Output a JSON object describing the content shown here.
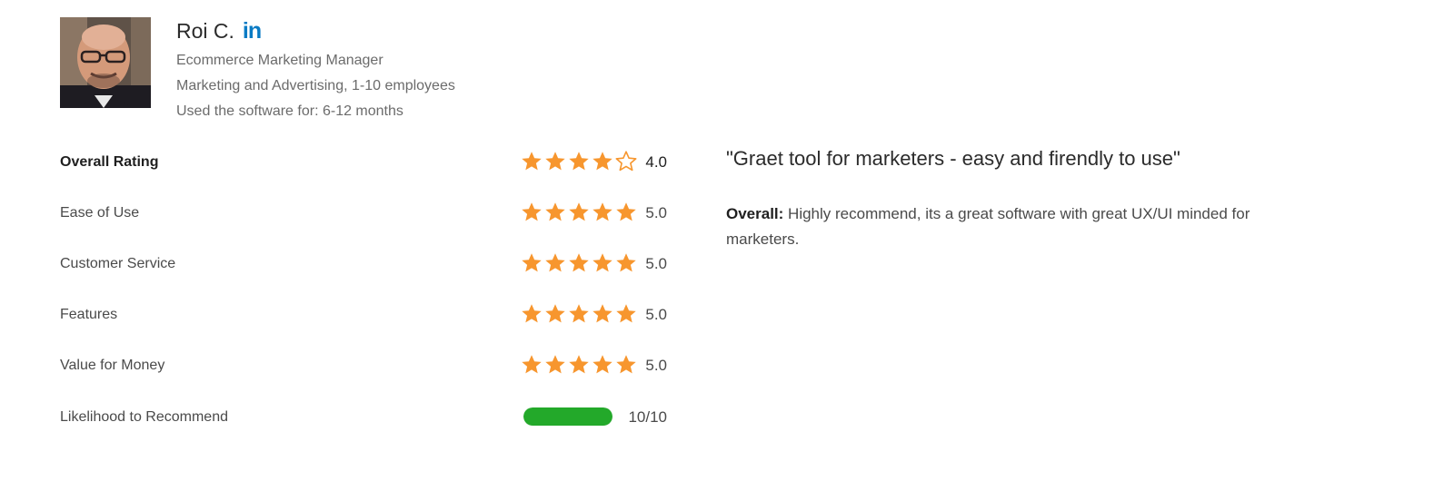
{
  "reviewer": {
    "name": "Roi C.",
    "linkedin_icon": "linkedin-icon",
    "job_title": "Ecommerce Marketing Manager",
    "industry": "Marketing and Advertising, 1-10 employees",
    "usage": "Used the software for: 6-12 months"
  },
  "ratings": [
    {
      "label": "Overall Rating",
      "stars": 4,
      "max": 5,
      "value": "4.0"
    },
    {
      "label": "Ease of Use",
      "stars": 5,
      "max": 5,
      "value": "5.0"
    },
    {
      "label": "Customer Service",
      "stars": 5,
      "max": 5,
      "value": "5.0"
    },
    {
      "label": "Features",
      "stars": 5,
      "max": 5,
      "value": "5.0"
    },
    {
      "label": "Value for Money",
      "stars": 5,
      "max": 5,
      "value": "5.0"
    }
  ],
  "recommend": {
    "label": "Likelihood to Recommend",
    "score": 10,
    "max": 10,
    "value": "10/10"
  },
  "review": {
    "title": "\"Graet tool for marketers - easy and firendly to use\"",
    "overall_label": "Overall:",
    "overall_text": "Highly recommend, its a great software with great UX/UI minded for marketers."
  },
  "colors": {
    "star": "#f7962e",
    "star_empty_stroke": "#f7962e",
    "recommend_bar": "#23a92a",
    "linkedin": "#0a7bc4"
  }
}
